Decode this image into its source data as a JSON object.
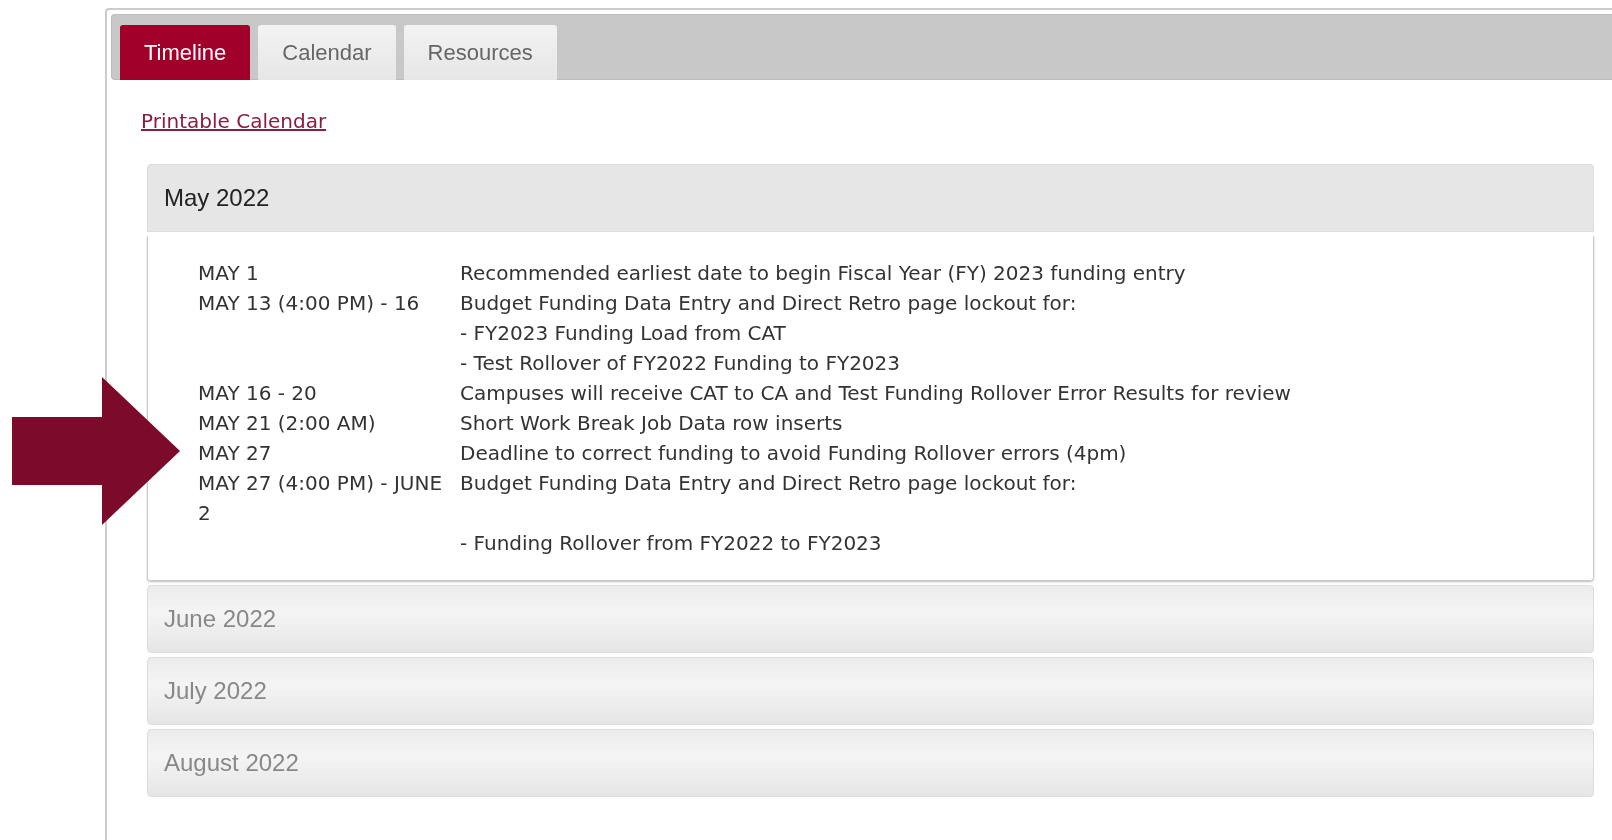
{
  "tabs": [
    {
      "label": "Timeline",
      "selected": true
    },
    {
      "label": "Calendar",
      "selected": false
    },
    {
      "label": "Resources",
      "selected": false
    }
  ],
  "link": "Printable Calendar",
  "months": [
    {
      "title": "May 2022",
      "expanded": true,
      "entries": [
        {
          "date": "MAY 1",
          "lines": [
            {
              "text": "Recommended earliest date to begin Fiscal Year (FY) 2023 funding entry",
              "spaced": false
            }
          ]
        },
        {
          "date": "MAY 13 (4:00 PM) - 16",
          "lines": [
            {
              "text": "Budget Funding Data Entry and Direct Retro page lockout for:",
              "spaced": false
            },
            {
              "text": "- FY2023 Funding Load from CAT",
              "spaced": false
            },
            {
              "text": "- Test Rollover of FY2022 Funding to FY2023",
              "spaced": false
            }
          ]
        },
        {
          "date": "MAY 16 - 20",
          "lines": [
            {
              "text": "Campuses will receive CAT to CA and Test Funding Rollover Error Results for review",
              "spaced": false
            }
          ]
        },
        {
          "date": "MAY 21 (2:00 AM)",
          "lines": [
            {
              "text": "Short Work Break Job Data row inserts",
              "spaced": false
            }
          ]
        },
        {
          "date": "MAY 27",
          "lines": [
            {
              "text": "Deadline to correct funding to avoid Funding Rollover errors (4pm)",
              "spaced": false
            }
          ]
        },
        {
          "date": "MAY 27 (4:00 PM) - JUNE 2",
          "lines": [
            {
              "text": "Budget Funding Data Entry and Direct Retro page lockout for:",
              "spaced": false
            },
            {
              "text": "- Funding Rollover from FY2022 to FY2023",
              "spaced": true
            }
          ]
        }
      ]
    },
    {
      "title": "June 2022",
      "expanded": false
    },
    {
      "title": "July 2022",
      "expanded": false
    },
    {
      "title": "August 2022",
      "expanded": false
    }
  ]
}
